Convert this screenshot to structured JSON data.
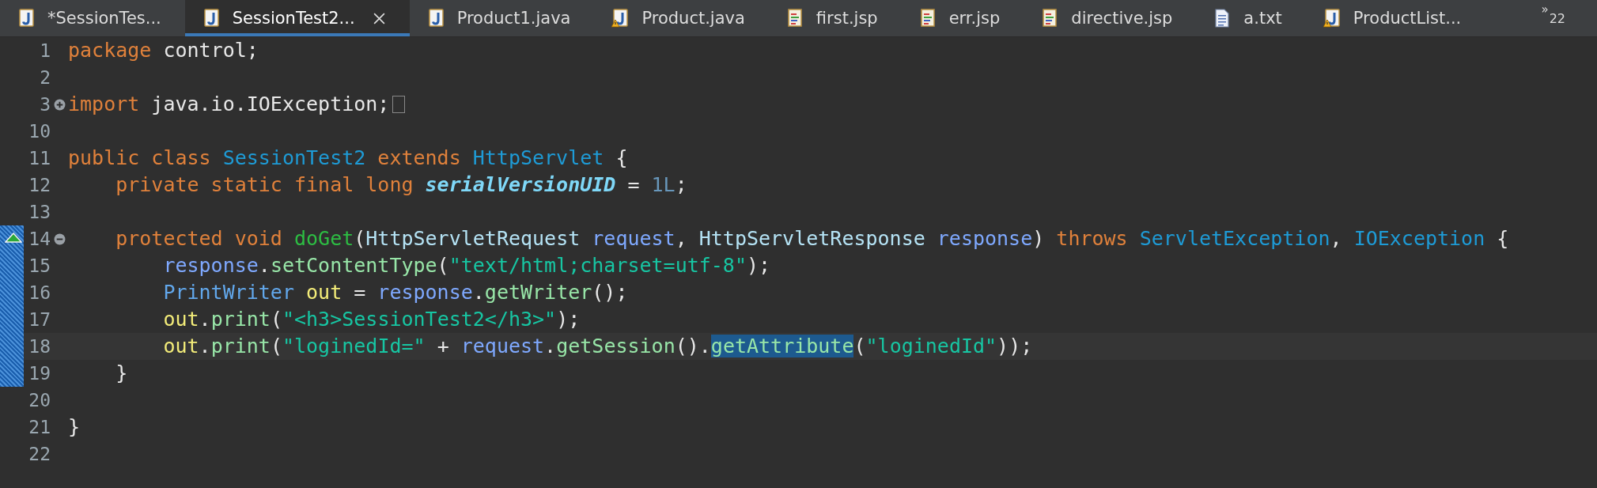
{
  "tabs": [
    {
      "label": "*SessionTes...",
      "kind": "java",
      "selected": false
    },
    {
      "label": "SessionTest2...",
      "kind": "java",
      "selected": true
    },
    {
      "label": "Product1.java",
      "kind": "java",
      "selected": false
    },
    {
      "label": "Product.java",
      "kind": "java-warning",
      "selected": false
    },
    {
      "label": "first.jsp",
      "kind": "jsp",
      "selected": false
    },
    {
      "label": "err.jsp",
      "kind": "jsp",
      "selected": false
    },
    {
      "label": "directive.jsp",
      "kind": "jsp",
      "selected": false
    },
    {
      "label": "a.txt",
      "kind": "txt",
      "selected": false
    },
    {
      "label": "ProductList...",
      "kind": "java-warning",
      "selected": false
    }
  ],
  "overflow": {
    "marker": "»",
    "count": "22"
  },
  "lines": [
    {
      "number": "1",
      "in_range": false,
      "tokens": [
        {
          "text": "package ",
          "kind": "keyword"
        },
        {
          "text": "control;",
          "kind": "plain"
        }
      ]
    },
    {
      "number": "2",
      "in_range": false
    },
    {
      "number": "3",
      "in_range": false,
      "fold_collapsed": true,
      "tokens": [
        {
          "text": "import ",
          "kind": "keyword"
        },
        {
          "text": "java.io.IOException;",
          "kind": "plain"
        }
      ]
    },
    {
      "number": "10",
      "in_range": false
    },
    {
      "number": "11",
      "in_range": false,
      "tokens": [
        {
          "text": "public class ",
          "kind": "keyword"
        },
        {
          "text": "SessionTest2",
          "kind": "class"
        },
        {
          "text": " extends ",
          "kind": "keyword"
        },
        {
          "text": "HttpServlet",
          "kind": "class"
        },
        {
          "text": " {",
          "kind": "plain"
        }
      ]
    },
    {
      "number": "12",
      "in_range": false,
      "tokens": [
        {
          "text": "    private static final long ",
          "kind": "keyword"
        },
        {
          "text": "serialVersionUID",
          "kind": "constant"
        },
        {
          "text": " = ",
          "kind": "plain"
        },
        {
          "text": "1L",
          "kind": "number"
        },
        {
          "text": ";",
          "kind": "plain"
        }
      ]
    },
    {
      "number": "13",
      "in_range": false
    },
    {
      "number": "14",
      "in_range": true,
      "fold_collapsed": false,
      "override": true,
      "tokens": [
        {
          "text": "    protected void ",
          "kind": "keyword"
        },
        {
          "text": "doGet",
          "kind": "method-declaration"
        },
        {
          "text": "(",
          "kind": "plain"
        },
        {
          "text": "HttpServletRequest ",
          "kind": "interface"
        },
        {
          "text": "request",
          "kind": "parameter"
        },
        {
          "text": ", ",
          "kind": "plain"
        },
        {
          "text": "HttpServletResponse ",
          "kind": "interface"
        },
        {
          "text": "response",
          "kind": "parameter"
        },
        {
          "text": ") ",
          "kind": "plain"
        },
        {
          "text": "throws ",
          "kind": "keyword"
        },
        {
          "text": "ServletException",
          "kind": "class"
        },
        {
          "text": ", ",
          "kind": "plain"
        },
        {
          "text": "IOException",
          "kind": "class"
        },
        {
          "text": " {",
          "kind": "plain"
        }
      ]
    },
    {
      "number": "15",
      "in_range": true,
      "tokens": [
        {
          "text": "        response",
          "kind": "parameter"
        },
        {
          "text": ".",
          "kind": "plain"
        },
        {
          "text": "setContentType",
          "kind": "method"
        },
        {
          "text": "(",
          "kind": "plain"
        },
        {
          "text": "\"text/html;charset=utf-8\"",
          "kind": "string"
        },
        {
          "text": ");",
          "kind": "plain"
        }
      ]
    },
    {
      "number": "16",
      "in_range": true,
      "tokens": [
        {
          "text": "        PrintWriter ",
          "kind": "type"
        },
        {
          "text": "out",
          "kind": "local"
        },
        {
          "text": " = ",
          "kind": "plain"
        },
        {
          "text": "response",
          "kind": "parameter"
        },
        {
          "text": ".",
          "kind": "plain"
        },
        {
          "text": "getWriter",
          "kind": "method"
        },
        {
          "text": "();",
          "kind": "plain"
        }
      ]
    },
    {
      "number": "17",
      "in_range": true,
      "tokens": [
        {
          "text": "        out",
          "kind": "local"
        },
        {
          "text": ".",
          "kind": "plain"
        },
        {
          "text": "print",
          "kind": "method"
        },
        {
          "text": "(",
          "kind": "plain"
        },
        {
          "text": "\"<h3>SessionTest2</h3>\"",
          "kind": "string"
        },
        {
          "text": ");",
          "kind": "plain"
        }
      ]
    },
    {
      "number": "18",
      "in_range": true,
      "current": true,
      "tokens": [
        {
          "text": "        out",
          "kind": "local"
        },
        {
          "text": ".",
          "kind": "plain"
        },
        {
          "text": "print",
          "kind": "method"
        },
        {
          "text": "(",
          "kind": "plain"
        },
        {
          "text": "\"loginedId=\"",
          "kind": "string"
        },
        {
          "text": " + ",
          "kind": "plain"
        },
        {
          "text": "request",
          "kind": "parameter"
        },
        {
          "text": ".",
          "kind": "plain"
        },
        {
          "text": "getSession",
          "kind": "method"
        },
        {
          "text": "().",
          "kind": "plain"
        },
        {
          "text": "getAttribute",
          "kind": "method",
          "selected": true
        },
        {
          "text": "(",
          "kind": "plain"
        },
        {
          "text": "\"loginedId\"",
          "kind": "string"
        },
        {
          "text": "));",
          "kind": "plain"
        }
      ]
    },
    {
      "number": "19",
      "in_range": true,
      "tokens": [
        {
          "text": "    }",
          "kind": "plain"
        }
      ]
    },
    {
      "number": "20",
      "in_range": false
    },
    {
      "number": "21",
      "in_range": false,
      "tokens": [
        {
          "text": "}",
          "kind": "plain"
        }
      ]
    },
    {
      "number": "22",
      "in_range": false
    }
  ]
}
